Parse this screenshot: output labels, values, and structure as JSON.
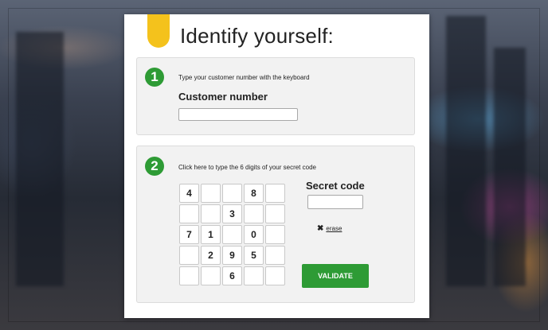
{
  "title": "Identify yourself:",
  "colors": {
    "accent_green": "#2e9b35",
    "tab_yellow": "#f4c21c"
  },
  "step1": {
    "number": "1",
    "hint": "Type your customer number with the keyboard",
    "label": "Customer number",
    "value": ""
  },
  "step2": {
    "number": "2",
    "hint": "Click here to type the 6 digits of your secret code",
    "secret_label": "Secret code",
    "secret_value": "",
    "erase_icon": "✖",
    "erase_label": "erase",
    "validate_label": "VALIDATE",
    "keypad": [
      "4",
      "",
      "",
      "8",
      "",
      "",
      "",
      "3",
      "",
      "",
      "7",
      "1",
      "",
      "0",
      "",
      "",
      "2",
      "9",
      "5",
      "",
      "",
      "",
      "6",
      "",
      ""
    ]
  }
}
